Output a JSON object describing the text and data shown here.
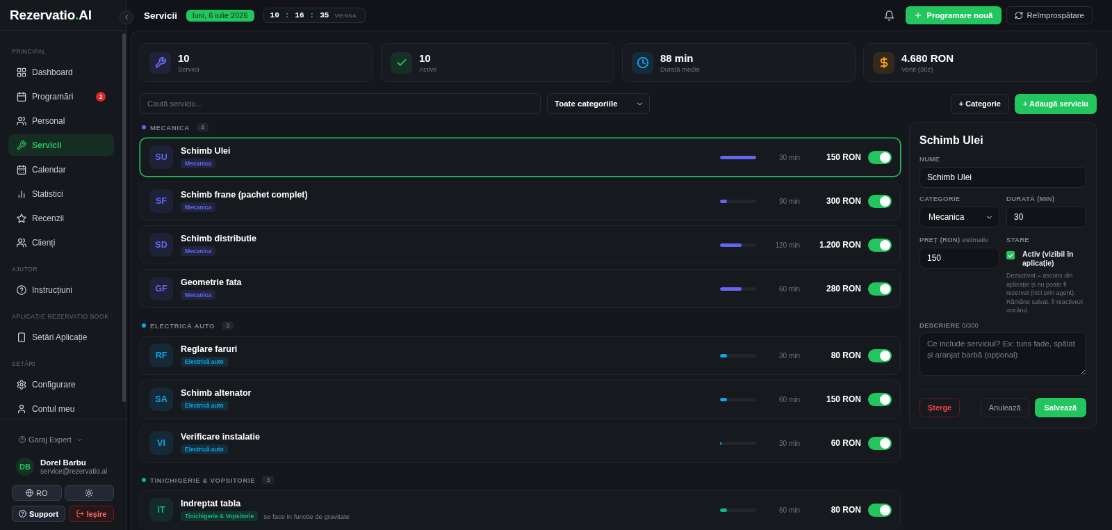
{
  "sidebar": {
    "logo": {
      "name": "Rezervatio",
      "dot": ".",
      "suffix": "AI"
    },
    "sections": [
      {
        "title": "PRINCIPAL",
        "items": [
          {
            "label": "Dashboard",
            "selected": false
          },
          {
            "label": "Programări",
            "badge": "2",
            "selected": false
          },
          {
            "label": "Personal",
            "selected": false
          },
          {
            "label": "Servicii",
            "selected": true
          },
          {
            "label": "Calendar",
            "selected": false
          },
          {
            "label": "Statistici",
            "selected": false
          },
          {
            "label": "Recenzii",
            "selected": false
          },
          {
            "label": "Clienți",
            "selected": false
          }
        ]
      },
      {
        "title": "AJUTOR",
        "items": [
          {
            "label": "Instrucțiuni",
            "selected": false
          }
        ]
      },
      {
        "title": "APLICAȚIE REZERVATIO BOOK",
        "items": [
          {
            "label": "Setări Aplicație",
            "selected": false
          }
        ]
      },
      {
        "title": "SETĂRI",
        "items": [
          {
            "label": "Configurare",
            "selected": false
          },
          {
            "label": "Contul meu",
            "selected": false
          }
        ]
      }
    ],
    "workspace": "Garaj Expert",
    "user": {
      "initials": "DB",
      "name": "Dorel Barbu",
      "email": "service@rezervatio.ai"
    },
    "language": "RO",
    "support": "Support",
    "logout": "Ieșire"
  },
  "header": {
    "title": "Servicii",
    "date": "luni, 6 iulie 2026",
    "clock": {
      "parts": [
        {
          "kind": "digits",
          "text": "10"
        },
        {
          "kind": "separator",
          "text": ":"
        },
        {
          "kind": "digits",
          "text": "16"
        },
        {
          "kind": "separator",
          "text": ":"
        },
        {
          "kind": "digits",
          "text": "35"
        }
      ],
      "zone": "VIENNA"
    },
    "new_button": "Programare nouă",
    "refresh_button": "Reîmprospătare"
  },
  "stats": [
    {
      "value": "10",
      "label": "Servicii",
      "color": "#6366f1"
    },
    {
      "value": "10",
      "label": "Active",
      "color": "#22c55e"
    },
    {
      "value": "88 min",
      "label": "Durată medie",
      "color": "#0ea5e9"
    },
    {
      "value": "4.680 RON",
      "label": "Venit (30z)",
      "color": "#f59e0b"
    }
  ],
  "toolbar": {
    "search": {
      "placeholder": "Caută serviciu..."
    },
    "category_filter": "Toate categoriile",
    "add_category": "+ Categorie",
    "add_service": "+ Adaugă serviciu"
  },
  "groups": [
    {
      "name": "MECANICA",
      "count": "4",
      "color": "#6366f1",
      "services": [
        {
          "initials": "SU",
          "name": "Schimb Ulei",
          "tag": "Mecanica",
          "level": 1,
          "duration": "30 min",
          "price": "150 RON",
          "on": true,
          "selected": true
        },
        {
          "initials": "SF",
          "name": "Schimb frane (pachet complet)",
          "tag": "Mecanica",
          "level": 0.2,
          "duration": "90 min",
          "price": "300 RON",
          "on": true,
          "selected": false
        },
        {
          "initials": "SD",
          "name": "Schimb distributie",
          "tag": "Mecanica",
          "level": 0.6,
          "duration": "120 min",
          "price": "1.200 RON",
          "on": true,
          "selected": false
        },
        {
          "initials": "GF",
          "name": "Geometrie fata",
          "tag": "Mecanica",
          "level": 0.6,
          "duration": "60 min",
          "price": "280 RON",
          "on": true,
          "selected": false
        }
      ]
    },
    {
      "name": "ELECTRICĂ AUTO",
      "count": "3",
      "color": "#0ea5e9",
      "services": [
        {
          "initials": "RF",
          "name": "Reglare faruri",
          "tag": "Electrică auto",
          "level": 0.2,
          "duration": "30 min",
          "price": "80 RON",
          "on": true,
          "selected": false
        },
        {
          "initials": "SA",
          "name": "Schimb altenator",
          "tag": "Electrică auto",
          "level": 0.2,
          "duration": "60 min",
          "price": "150 RON",
          "on": true,
          "selected": false
        },
        {
          "initials": "VI",
          "name": "Verificare instalatie",
          "tag": "Electrică auto",
          "level": 0.03,
          "duration": "30 min",
          "price": "60 RON",
          "on": true,
          "selected": false
        }
      ]
    },
    {
      "name": "TINICHIGERIE & VOPSITORIE",
      "count": "3",
      "color": "#10b981",
      "services": [
        {
          "initials": "IT",
          "name": "Indreptat tabla",
          "tag": "Tinichigerie & Vopsitorie",
          "note": "se face in functie de gravitate",
          "level": 0.2,
          "duration": "60 min",
          "price": "80 RON",
          "on": true,
          "selected": false
        }
      ]
    }
  ],
  "editor": {
    "title": "Schimb Ulei",
    "name": {
      "label": "NUME",
      "value": "Schimb Ulei"
    },
    "category": {
      "label": "CATEGORIE",
      "value": "Mecanica"
    },
    "duration": {
      "label": "DURATĂ (MIN)",
      "value": "30"
    },
    "price": {
      "label": "PREȚ (RON)",
      "hint": "estimativ",
      "value": "150"
    },
    "status": {
      "label": "STARE",
      "checkbox_label": "Activ (vizibil în aplicație)",
      "checked": true,
      "help": "Dezactivat = ascuns din aplicație și nu poate fi rezervat (nici prin agent). Rămâne salvat, îl reactivezi oricând."
    },
    "description": {
      "label": "DESCRIERE",
      "counter": "0/300",
      "placeholder": "Ce include serviciul? Ex: tuns fade, spălat și aranjat barbă (opțional)"
    },
    "buttons": {
      "delete": "Șterge",
      "cancel": "Anulează",
      "save": "Salvează"
    }
  }
}
